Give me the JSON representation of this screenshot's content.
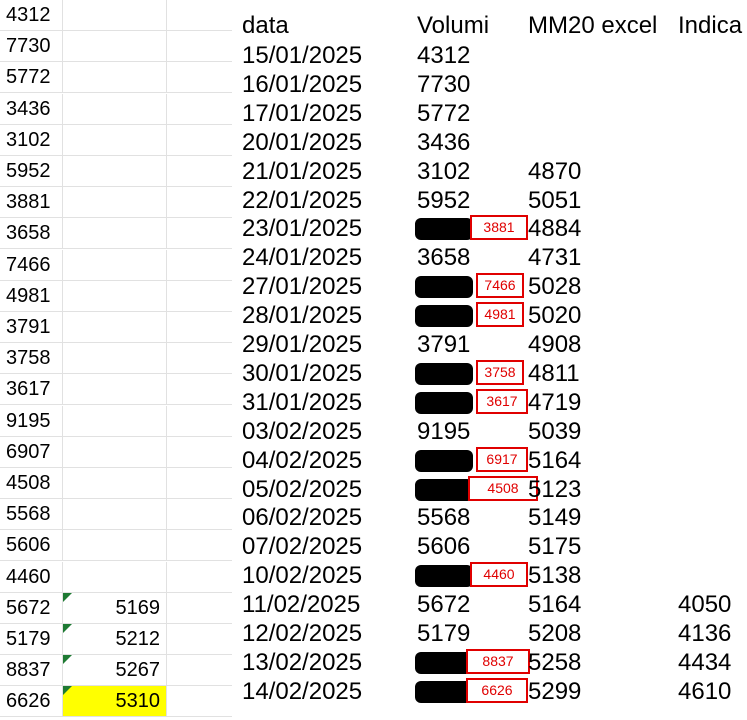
{
  "grid": {
    "rows": [
      {
        "a": "4312",
        "b": ""
      },
      {
        "a": "7730",
        "b": ""
      },
      {
        "a": "5772",
        "b": ""
      },
      {
        "a": "3436",
        "b": ""
      },
      {
        "a": "3102",
        "b": ""
      },
      {
        "a": "5952",
        "b": ""
      },
      {
        "a": "3881",
        "b": ""
      },
      {
        "a": "3658",
        "b": ""
      },
      {
        "a": "7466",
        "b": ""
      },
      {
        "a": "4981",
        "b": ""
      },
      {
        "a": "3791",
        "b": ""
      },
      {
        "a": "3758",
        "b": ""
      },
      {
        "a": "3617",
        "b": ""
      },
      {
        "a": "9195",
        "b": ""
      },
      {
        "a": "6907",
        "b": ""
      },
      {
        "a": "4508",
        "b": ""
      },
      {
        "a": "5568",
        "b": ""
      },
      {
        "a": "5606",
        "b": ""
      },
      {
        "a": "4460",
        "b": ""
      },
      {
        "a": "5672",
        "b": "5169",
        "flag": true
      },
      {
        "a": "5179",
        "b": "5212",
        "flag": true
      },
      {
        "a": "8837",
        "b": "5267",
        "flag": true
      },
      {
        "a": "6626",
        "b": "5310",
        "flag": true,
        "highlight": true
      }
    ]
  },
  "table": {
    "headers": {
      "date": "data",
      "volumi": "Volumi",
      "mm20": "MM20 excel",
      "indicator": "Indica"
    },
    "rows": [
      {
        "date": "15/01/2025",
        "vol": "4312",
        "mm": "",
        "ind": ""
      },
      {
        "date": "16/01/2025",
        "vol": "7730",
        "mm": "",
        "ind": ""
      },
      {
        "date": "17/01/2025",
        "vol": "5772",
        "mm": "",
        "ind": ""
      },
      {
        "date": "20/01/2025",
        "vol": "3436",
        "mm": "",
        "ind": ""
      },
      {
        "date": "21/01/2025",
        "vol": "3102",
        "mm": "4870",
        "ind": ""
      },
      {
        "date": "22/01/2025",
        "vol": "5952",
        "mm": "5051",
        "ind": ""
      },
      {
        "date": "23/01/2025",
        "vol": "",
        "fix": "3881",
        "mm": "4884",
        "ind": ""
      },
      {
        "date": "24/01/2025",
        "vol": "3658",
        "mm": "4731",
        "ind": ""
      },
      {
        "date": "27/01/2025",
        "vol": "",
        "fix": "7466",
        "mm": "5028",
        "ind": ""
      },
      {
        "date": "28/01/2025",
        "vol": "",
        "fix": "4981",
        "mm": "5020",
        "ind": ""
      },
      {
        "date": "29/01/2025",
        "vol": "3791",
        "mm": "4908",
        "ind": ""
      },
      {
        "date": "30/01/2025",
        "vol": "",
        "fix": "3758",
        "mm": "4811",
        "ind": ""
      },
      {
        "date": "31/01/2025",
        "vol": "",
        "fix": "3617",
        "mm": "4719",
        "ind": ""
      },
      {
        "date": "03/02/2025",
        "vol": "9195",
        "mm": "5039",
        "ind": ""
      },
      {
        "date": "04/02/2025",
        "vol": "",
        "fix": "6917",
        "mm": "5164",
        "ind": ""
      },
      {
        "date": "05/02/2025",
        "vol": "",
        "fix": "4508",
        "mm": "5123",
        "ind": ""
      },
      {
        "date": "06/02/2025",
        "vol": "5568",
        "mm": "5149",
        "ind": ""
      },
      {
        "date": "07/02/2025",
        "vol": "5606",
        "mm": "5175",
        "ind": ""
      },
      {
        "date": "10/02/2025",
        "vol": "",
        "fix": "4460",
        "mm": "5138",
        "ind": ""
      },
      {
        "date": "11/02/2025",
        "vol": "5672",
        "mm": "5164",
        "ind": "4050"
      },
      {
        "date": "12/02/2025",
        "vol": "5179",
        "mm": "5208",
        "ind": "4136"
      },
      {
        "date": "13/02/2025",
        "vol": "",
        "fix": "8837",
        "mm": "5258",
        "ind": "4434"
      },
      {
        "date": "14/02/2025",
        "vol": "",
        "fix": "6626",
        "mm": "5299",
        "ind": "4610"
      }
    ]
  },
  "colors": {
    "highlight": "#ffff00",
    "annotation": "#e00000",
    "flag": "#1e7a33"
  }
}
